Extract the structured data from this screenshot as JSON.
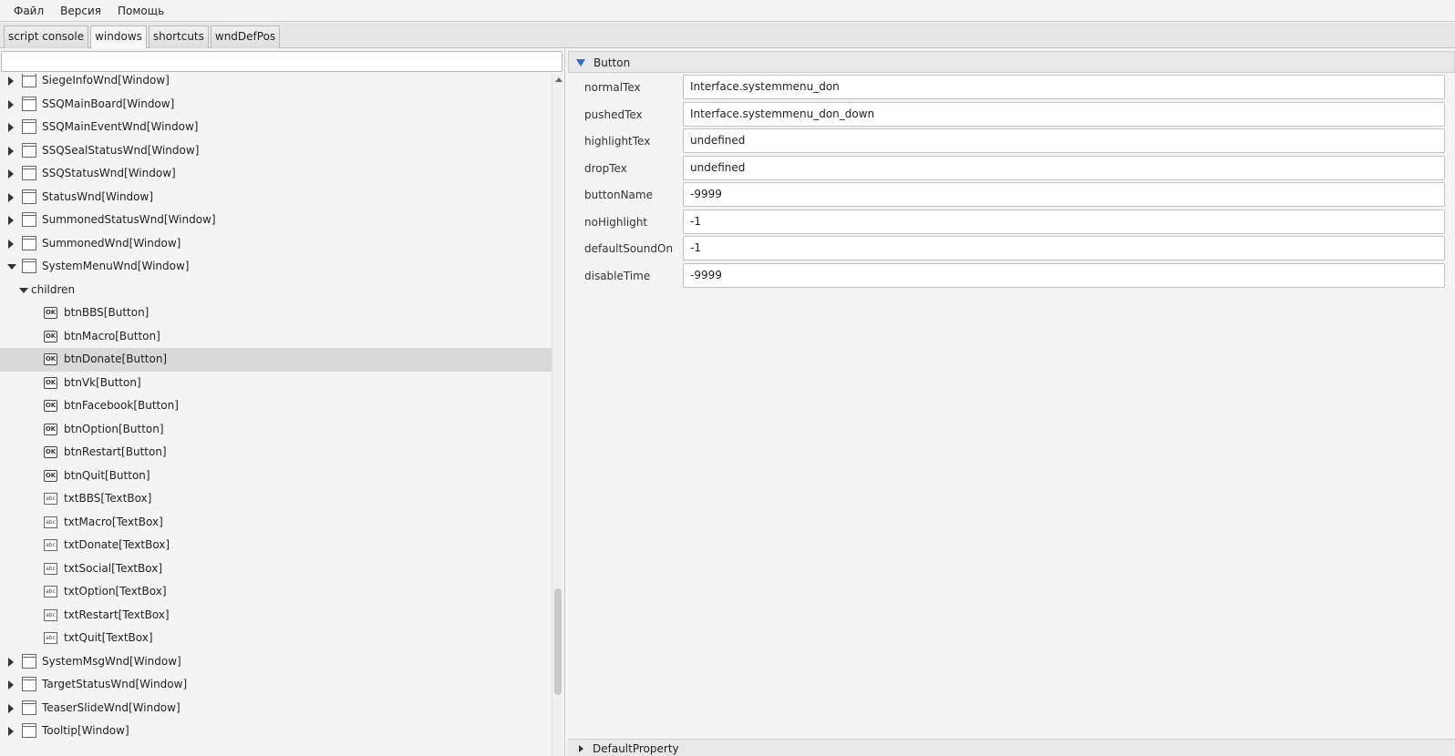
{
  "menubar": [
    "Файл",
    "Версия",
    "Помощь"
  ],
  "tabs": [
    {
      "label": "script console",
      "active": false
    },
    {
      "label": "windows",
      "active": true
    },
    {
      "label": "shortcuts",
      "active": false
    },
    {
      "label": "wndDefPos",
      "active": false
    }
  ],
  "tree": [
    {
      "label": "SiegeInfoWnd[Window]",
      "level": 0,
      "type": "window",
      "expanded": false
    },
    {
      "label": "SSQMainBoard[Window]",
      "level": 0,
      "type": "window",
      "expanded": false
    },
    {
      "label": "SSQMainEventWnd[Window]",
      "level": 0,
      "type": "window",
      "expanded": false
    },
    {
      "label": "SSQSealStatusWnd[Window]",
      "level": 0,
      "type": "window",
      "expanded": false
    },
    {
      "label": "SSQStatusWnd[Window]",
      "level": 0,
      "type": "window",
      "expanded": false
    },
    {
      "label": "StatusWnd[Window]",
      "level": 0,
      "type": "window",
      "expanded": false
    },
    {
      "label": "SummonedStatusWnd[Window]",
      "level": 0,
      "type": "window",
      "expanded": false
    },
    {
      "label": "SummonedWnd[Window]",
      "level": 0,
      "type": "window",
      "expanded": false
    },
    {
      "label": "SystemMenuWnd[Window]",
      "level": 0,
      "type": "window",
      "expanded": true
    },
    {
      "label": "children",
      "level": 1,
      "type": "folder",
      "expanded": true
    },
    {
      "label": "btnBBS[Button]",
      "level": 2,
      "type": "button"
    },
    {
      "label": "btnMacro[Button]",
      "level": 2,
      "type": "button"
    },
    {
      "label": "btnDonate[Button]",
      "level": 2,
      "type": "button",
      "selected": true
    },
    {
      "label": "btnVk[Button]",
      "level": 2,
      "type": "button"
    },
    {
      "label": "btnFacebook[Button]",
      "level": 2,
      "type": "button"
    },
    {
      "label": "btnOption[Button]",
      "level": 2,
      "type": "button"
    },
    {
      "label": "btnRestart[Button]",
      "level": 2,
      "type": "button"
    },
    {
      "label": "btnQuit[Button]",
      "level": 2,
      "type": "button"
    },
    {
      "label": "txtBBS[TextBox]",
      "level": 2,
      "type": "textbox"
    },
    {
      "label": "txtMacro[TextBox]",
      "level": 2,
      "type": "textbox"
    },
    {
      "label": "txtDonate[TextBox]",
      "level": 2,
      "type": "textbox"
    },
    {
      "label": "txtSocial[TextBox]",
      "level": 2,
      "type": "textbox"
    },
    {
      "label": "txtOption[TextBox]",
      "level": 2,
      "type": "textbox"
    },
    {
      "label": "txtRestart[TextBox]",
      "level": 2,
      "type": "textbox"
    },
    {
      "label": "txtQuit[TextBox]",
      "level": 2,
      "type": "textbox"
    },
    {
      "label": "SystemMsgWnd[Window]",
      "level": 0,
      "type": "window",
      "expanded": false
    },
    {
      "label": "TargetStatusWnd[Window]",
      "level": 0,
      "type": "window",
      "expanded": false
    },
    {
      "label": "TeaserSlideWnd[Window]",
      "level": 0,
      "type": "window",
      "expanded": false
    },
    {
      "label": "Tooltip[Window]",
      "level": 0,
      "type": "window",
      "expanded": false
    }
  ],
  "icons": {
    "button_icon": "OK",
    "textbox_icon": "abc"
  },
  "properties": {
    "section_title": "Button",
    "rows": [
      {
        "name": "normalTex",
        "value": "Interface.systemmenu_don"
      },
      {
        "name": "pushedTex",
        "value": "Interface.systemmenu_don_down"
      },
      {
        "name": "highlightTex",
        "value": "undefined"
      },
      {
        "name": "dropTex",
        "value": "undefined"
      },
      {
        "name": "buttonName",
        "value": "-9999"
      },
      {
        "name": "noHighlight",
        "value": "-1"
      },
      {
        "name": "defaultSoundOn",
        "value": "-1"
      },
      {
        "name": "disableTime",
        "value": "-9999"
      }
    ],
    "footer_title": "DefaultProperty"
  },
  "search": {
    "value": ""
  }
}
